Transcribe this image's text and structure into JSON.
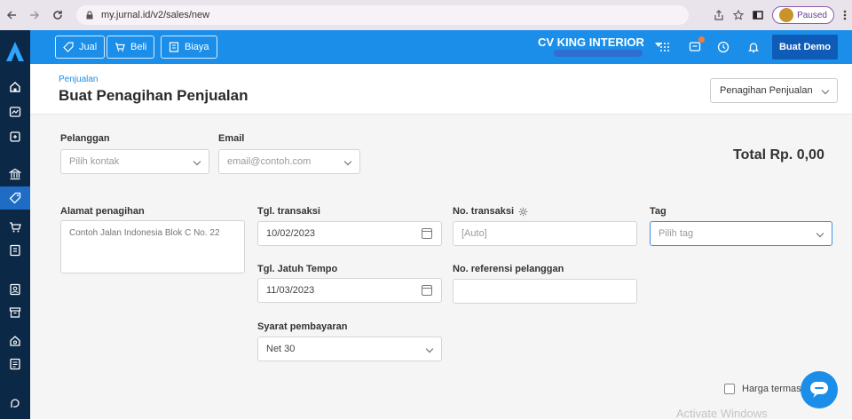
{
  "browser": {
    "url": "my.jurnal.id/v2/sales/new",
    "paused_label": "Paused"
  },
  "topbar": {
    "jual_label": "Jual",
    "beli_label": "Beli",
    "biaya_label": "Biaya",
    "company_name": "CV KING INTERIOR",
    "demo_label": "Buat Demo"
  },
  "header": {
    "breadcrumb": "Penjualan",
    "title": "Buat Penagihan Penjualan",
    "type_select": "Penagihan Penjualan"
  },
  "form": {
    "customer_label": "Pelanggan",
    "customer_placeholder": "Pilih kontak",
    "email_label": "Email",
    "email_placeholder": "email@contoh.com",
    "total_label": "Total Rp. 0,00",
    "billing_address_label": "Alamat penagihan",
    "billing_address_placeholder": "Contoh Jalan Indonesia Blok C No. 22",
    "transaction_date_label": "Tgl. transaksi",
    "transaction_date_value": "10/02/2023",
    "due_date_label": "Tgl. Jatuh Tempo",
    "due_date_value": "11/03/2023",
    "transaction_no_label": "No. transaksi",
    "transaction_no_value": "[Auto]",
    "customer_ref_label": "No. referensi pelanggan",
    "customer_ref_value": "",
    "tag_label": "Tag",
    "tag_placeholder": "Pilih tag",
    "payment_terms_label": "Syarat pembayaran",
    "payment_terms_value": "Net 30",
    "price_incl_tax_label": "Harga termasuk"
  },
  "overlay": {
    "activate_windows": "Activate Windows"
  },
  "colors": {
    "topbar": "#1a8ee8",
    "sidebar": "#0b2847",
    "accent_dark": "#0f5cb8",
    "link": "#1a8ee8"
  }
}
